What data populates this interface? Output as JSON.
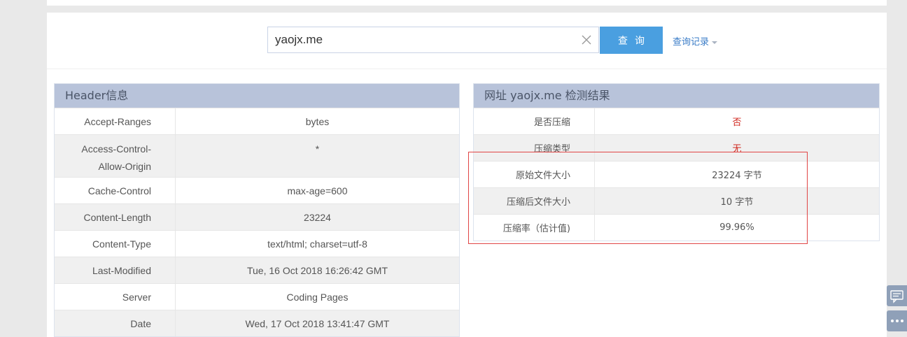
{
  "search": {
    "value": "yaojx.me",
    "button_label": "查询",
    "history_label": "查询记录"
  },
  "header_panel": {
    "title": "Header信息",
    "rows": [
      {
        "key": "Accept-Ranges",
        "value": "bytes"
      },
      {
        "key": "Access-Control-Allow-Origin",
        "key_line1": "Access-Control-",
        "key_line2": "Allow-Origin",
        "value": "*"
      },
      {
        "key": "Cache-Control",
        "value": "max-age=600"
      },
      {
        "key": "Content-Length",
        "value": "23224"
      },
      {
        "key": "Content-Type",
        "value": "text/html; charset=utf-8"
      },
      {
        "key": "Last-Modified",
        "value": "Tue, 16 Oct 2018 16:26:42 GMT"
      },
      {
        "key": "Server",
        "value": "Coding Pages"
      },
      {
        "key": "Date",
        "value": "Wed, 17 Oct 2018 13:41:47 GMT"
      }
    ]
  },
  "result_panel": {
    "title": "网址 yaojx.me 检测结果",
    "rows": [
      {
        "key": "是否压缩",
        "value": "否"
      },
      {
        "key": "压缩类型",
        "value": "无"
      },
      {
        "key": "原始文件大小",
        "value": "23224 字节"
      },
      {
        "key": "压缩后文件大小",
        "value": "10 字节"
      },
      {
        "key": "压缩率（估计值)",
        "value": "99.96%"
      }
    ]
  },
  "colors": {
    "accent": "#4a9fe0",
    "panel_header": "#b8c3da",
    "warning_text": "#d0281f",
    "highlight_border": "#e04545"
  },
  "icons": {
    "clear": "close-icon",
    "feedback": "chat-icon",
    "more": "more-dots-icon"
  }
}
